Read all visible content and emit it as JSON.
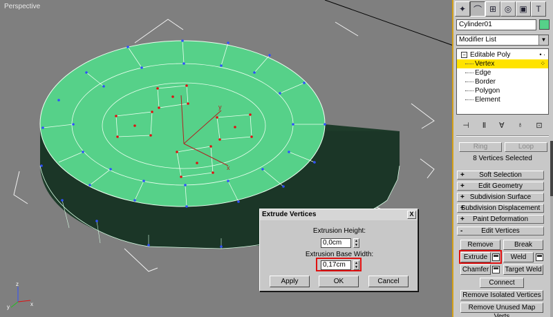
{
  "viewport": {
    "label": "Perspective"
  },
  "object": {
    "name": "Cylinder01",
    "color": "#56d189"
  },
  "modifier_list": {
    "label": "Modifier List"
  },
  "stack": {
    "root": "Editable Poly",
    "items": [
      "Vertex",
      "Edge",
      "Border",
      "Polygon",
      "Element"
    ],
    "selected": "Vertex"
  },
  "selection": {
    "ring": "Ring",
    "loop": "Loop",
    "status": "8 Vertices Selected"
  },
  "rollouts": [
    {
      "sign": "+",
      "label": "Soft Selection"
    },
    {
      "sign": "+",
      "label": "Edit Geometry"
    },
    {
      "sign": "+",
      "label": "Subdivision Surface"
    },
    {
      "sign": "+",
      "label": "Subdivision Displacement"
    },
    {
      "sign": "+",
      "label": "Paint Deformation"
    },
    {
      "sign": "-",
      "label": "Edit Vertices"
    }
  ],
  "edit_vertices": {
    "remove": "Remove",
    "break": "Break",
    "extrude": "Extrude",
    "weld": "Weld",
    "chamfer": "Chamfer",
    "target_weld": "Target Weld",
    "connect": "Connect",
    "remove_isolated": "Remove Isolated Vertices",
    "remove_unused": "Remove Unused Map Verts"
  },
  "dialog": {
    "title": "Extrude Vertices",
    "close": "X",
    "height_label": "Extrusion Height:",
    "height_value": "0,0cm",
    "width_label": "Extrusion Base Width:",
    "width_value": "0,17cm",
    "apply": "Apply",
    "ok": "OK",
    "cancel": "Cancel"
  },
  "axis": {
    "x": "x",
    "y": "y",
    "z": "z"
  }
}
